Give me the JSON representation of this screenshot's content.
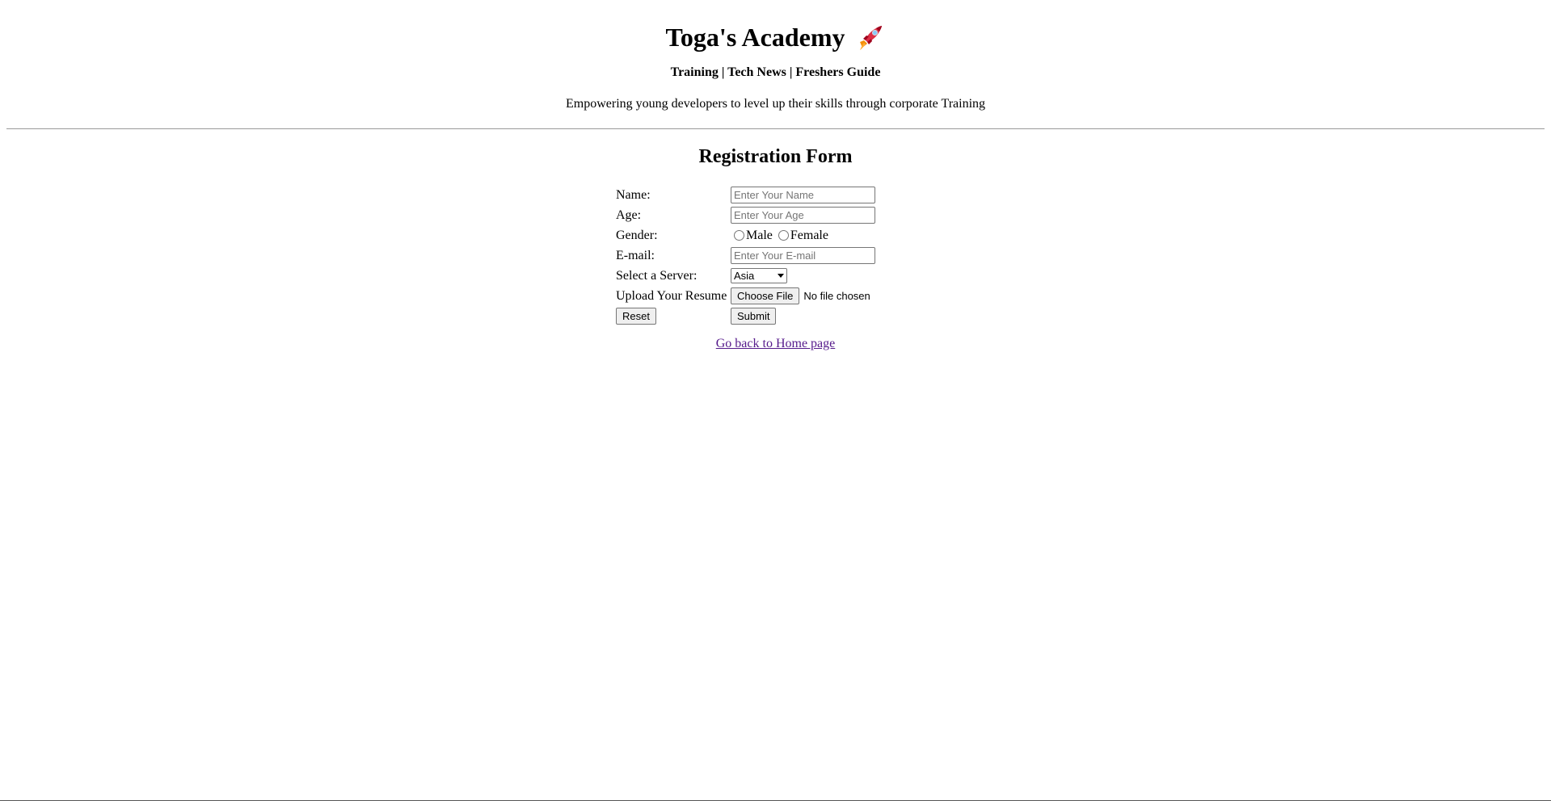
{
  "header": {
    "title": "Toga's Academy",
    "nav": [
      "Training",
      "Tech News",
      "Freshers Guide"
    ],
    "nav_separator": "|",
    "tagline": "Empowering young developers to level up their skills through corporate Training"
  },
  "form": {
    "title": "Registration Form",
    "name_label": "Name:",
    "name_placeholder": "Enter Your Name",
    "age_label": "Age:",
    "age_placeholder": "Enter Your Age",
    "gender_label": "Gender:",
    "gender_options": [
      "Male",
      "Female"
    ],
    "email_label": "E-mail:",
    "email_placeholder": "Enter Your E-mail",
    "server_label": "Select a Server:",
    "server_selected": "Asia",
    "resume_label": "Upload Your Resume",
    "file_button": "Choose File",
    "file_status": "No file chosen",
    "reset_label": "Reset",
    "submit_label": "Submit"
  },
  "footer": {
    "home_link": "Go back to Home page"
  },
  "icons": {
    "title_icon": "rocket-icon"
  },
  "colors": {
    "link_visited": "#551a8b",
    "divider": "#9a9a9a"
  }
}
